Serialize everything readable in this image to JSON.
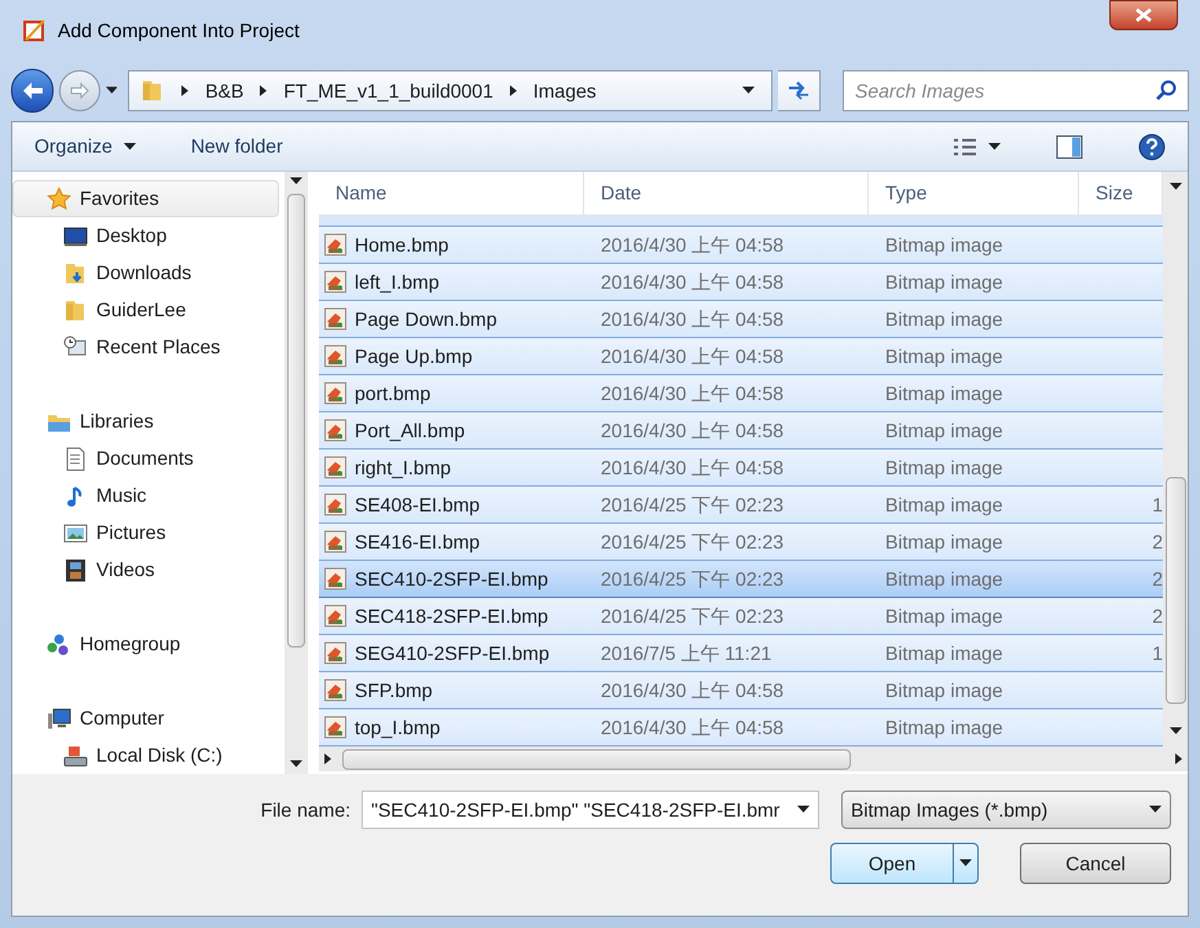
{
  "window": {
    "title": "Add Component Into Project"
  },
  "address": {
    "crumbs": [
      "B&B",
      "FT_ME_v1_1_build0001",
      "Images"
    ]
  },
  "search": {
    "placeholder": "Search Images"
  },
  "toolbar": {
    "organize": "Organize",
    "new_folder": "New folder"
  },
  "sidebar": {
    "groups": [
      {
        "label": "Favorites",
        "kind": "star",
        "selected": true,
        "children": [
          {
            "label": "Desktop",
            "kind": "desktop"
          },
          {
            "label": "Downloads",
            "kind": "downloads"
          },
          {
            "label": "GuiderLee",
            "kind": "folder"
          },
          {
            "label": "Recent Places",
            "kind": "recent"
          }
        ]
      },
      {
        "label": "Libraries",
        "kind": "library",
        "selected": false,
        "children": [
          {
            "label": "Documents",
            "kind": "document"
          },
          {
            "label": "Music",
            "kind": "music"
          },
          {
            "label": "Pictures",
            "kind": "pictures"
          },
          {
            "label": "Videos",
            "kind": "videos"
          }
        ]
      },
      {
        "label": "Homegroup",
        "kind": "homegroup",
        "selected": false
      },
      {
        "label": "Computer",
        "kind": "computer",
        "selected": false,
        "children": [
          {
            "label": "Local Disk (C:)",
            "kind": "disk"
          }
        ]
      }
    ]
  },
  "table": {
    "columns": [
      "Name",
      "Date",
      "Type",
      "Size"
    ],
    "rows": [
      {
        "name": "Home.bmp",
        "date": "2016/4/30 上午 04:58",
        "type": "Bitmap image",
        "selected": true,
        "focused": false
      },
      {
        "name": "left_I.bmp",
        "date": "2016/4/30 上午 04:58",
        "type": "Bitmap image",
        "selected": true,
        "focused": false
      },
      {
        "name": "Page Down.bmp",
        "date": "2016/4/30 上午 04:58",
        "type": "Bitmap image",
        "selected": true,
        "focused": false
      },
      {
        "name": "Page Up.bmp",
        "date": "2016/4/30 上午 04:58",
        "type": "Bitmap image",
        "selected": true,
        "focused": false
      },
      {
        "name": "port.bmp",
        "date": "2016/4/30 上午 04:58",
        "type": "Bitmap image",
        "selected": true,
        "focused": false
      },
      {
        "name": "Port_All.bmp",
        "date": "2016/4/30 上午 04:58",
        "type": "Bitmap image",
        "selected": true,
        "focused": false
      },
      {
        "name": "right_I.bmp",
        "date": "2016/4/30 上午 04:58",
        "type": "Bitmap image",
        "selected": true,
        "focused": false
      },
      {
        "name": "SE408-EI.bmp",
        "date": "2016/4/25 下午 02:23",
        "type": "Bitmap image",
        "size": "1",
        "selected": true,
        "focused": false
      },
      {
        "name": "SE416-EI.bmp",
        "date": "2016/4/25 下午 02:23",
        "type": "Bitmap image",
        "size": "2",
        "selected": true,
        "focused": false
      },
      {
        "name": "SEC410-2SFP-EI.bmp",
        "date": "2016/4/25 下午 02:23",
        "type": "Bitmap image",
        "size": "2",
        "selected": true,
        "focused": true
      },
      {
        "name": "SEC418-2SFP-EI.bmp",
        "date": "2016/4/25 下午 02:23",
        "type": "Bitmap image",
        "size": "2",
        "selected": true,
        "focused": false
      },
      {
        "name": "SEG410-2SFP-EI.bmp",
        "date": "2016/7/5 上午 11:21",
        "type": "Bitmap image",
        "size": "1",
        "selected": true,
        "focused": false
      },
      {
        "name": "SFP.bmp",
        "date": "2016/4/30 上午 04:58",
        "type": "Bitmap image",
        "selected": true,
        "focused": false
      },
      {
        "name": "top_I.bmp",
        "date": "2016/4/30 上午 04:58",
        "type": "Bitmap image",
        "selected": true,
        "focused": false
      }
    ]
  },
  "file_name": {
    "label": "File name:",
    "value": "\"SEC410-2SFP-EI.bmp\" \"SEC418-2SFP-EI.bmr"
  },
  "file_type": {
    "value": "Bitmap Images (*.bmp)"
  },
  "buttons": {
    "open": "Open",
    "cancel": "Cancel"
  }
}
